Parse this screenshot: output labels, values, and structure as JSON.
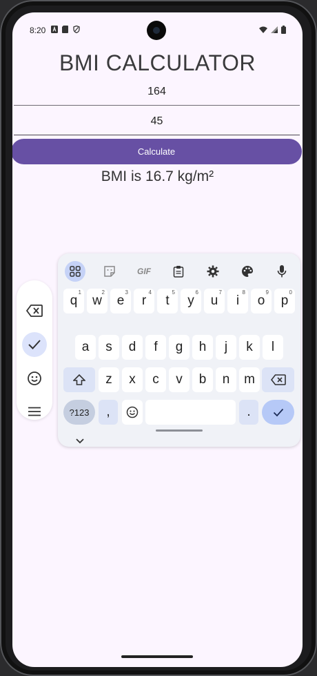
{
  "status_bar": {
    "time": "8:20"
  },
  "app": {
    "title": "BMI CALCULATOR",
    "height_value": "164",
    "weight_value": "45",
    "calculate_label": "Calculate",
    "result_text": "BMI is 16.7 kg/m²"
  },
  "floating_toolbar": {
    "items": [
      "backspace-icon",
      "check-icon",
      "emoji-icon",
      "menu-icon"
    ],
    "active_item": "check-icon"
  },
  "keyboard": {
    "toolbar_icons": [
      "apps-grid-icon",
      "sticker-icon",
      "gif-icon",
      "clipboard-icon",
      "gear-icon",
      "palette-icon",
      "mic-icon"
    ],
    "gif_label": "GIF",
    "row1": [
      "q",
      "w",
      "e",
      "r",
      "t",
      "y",
      "u",
      "i",
      "o",
      "p"
    ],
    "row1_hints": [
      "1",
      "2",
      "3",
      "4",
      "5",
      "6",
      "7",
      "8",
      "9",
      "0"
    ],
    "row2": [
      "a",
      "s",
      "d",
      "f",
      "g",
      "h",
      "j",
      "k",
      "l"
    ],
    "row3": [
      "z",
      "x",
      "c",
      "v",
      "b",
      "n",
      "m"
    ],
    "symbols_label": "?123",
    "comma_label": ",",
    "period_label": ".",
    "colors": {
      "accent": "#6750a4",
      "enter_key": "#b6c9f7",
      "modifier_key": "#dce3f6"
    }
  }
}
